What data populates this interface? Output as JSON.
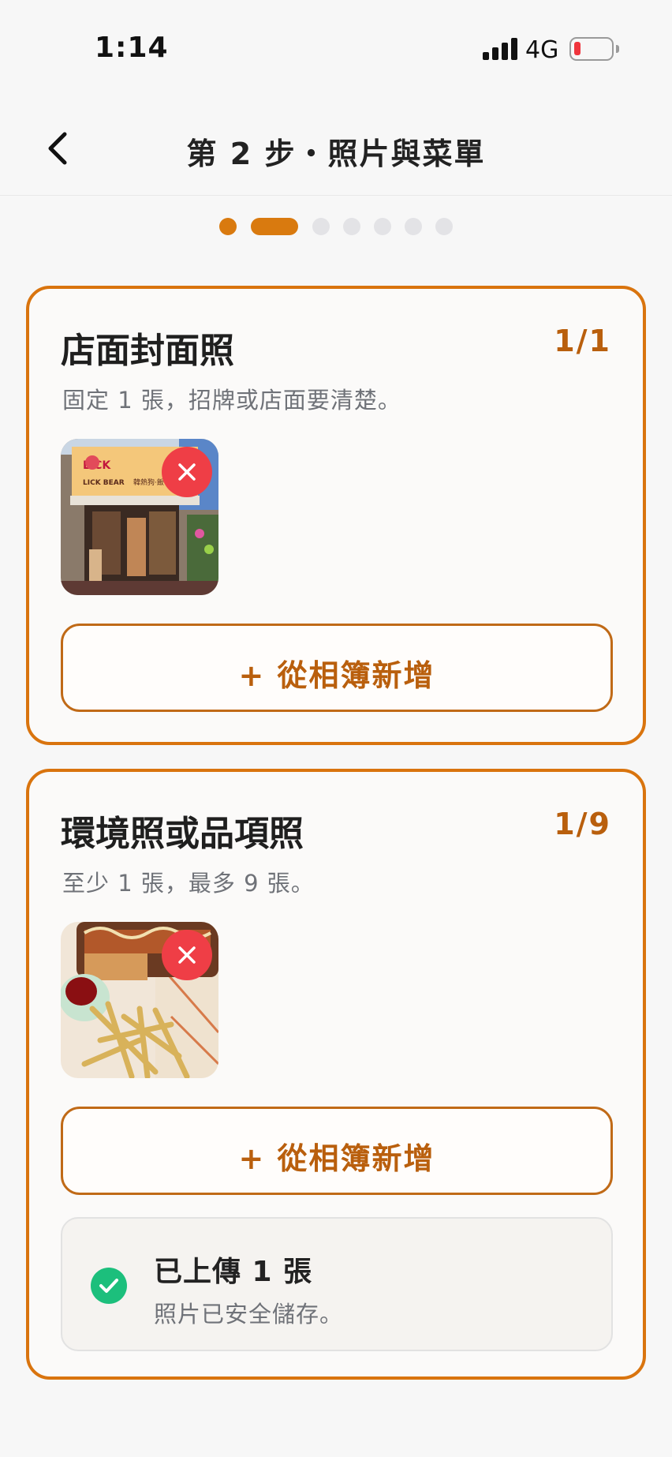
{
  "status_bar": {
    "time": "1:14",
    "network": "4G"
  },
  "header": {
    "title": "第 2 步・照片與菜單"
  },
  "stepper": {
    "steps": [
      "done",
      "active",
      "todo",
      "todo",
      "todo",
      "todo",
      "todo"
    ]
  },
  "cover_section": {
    "title": "店面封面照",
    "count": "1/1",
    "description": "固定 1 張，招牌或店面要清楚。",
    "photo_sign_text": [
      "LICK",
      "LICK BEAR",
      "韓熱狗·飯"
    ],
    "add_button_label": "+ 從相簿新增"
  },
  "gallery_section": {
    "title": "環境照或品項照",
    "count": "1/9",
    "description": "至少 1 張，最多 9 張。",
    "add_button_label": "+ 從相簿新增",
    "upload_status": {
      "title": "已上傳 1 張",
      "subtitle": "照片已安全儲存。"
    }
  },
  "colors": {
    "accent": "#d9740e",
    "remove": "#ef3e46",
    "success": "#1cbf7c"
  }
}
